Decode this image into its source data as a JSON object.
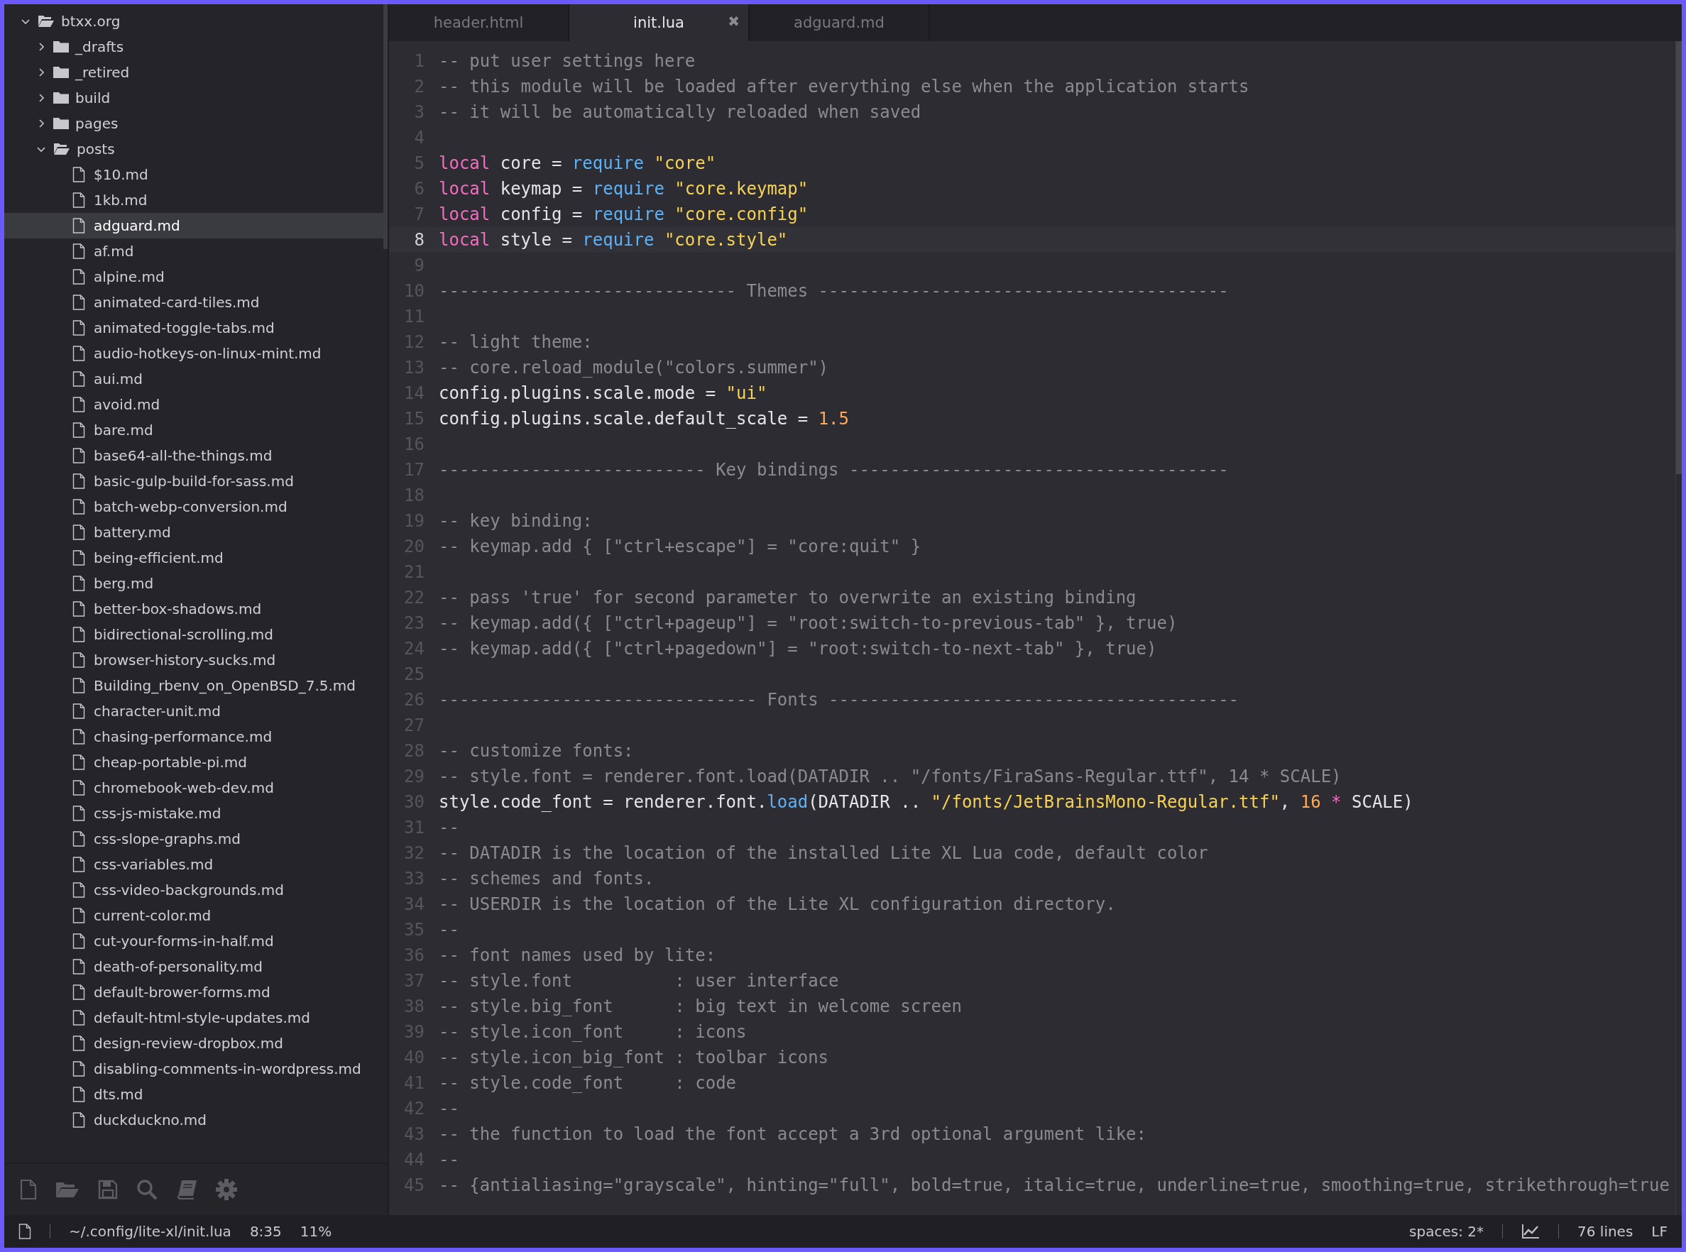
{
  "sidebar": {
    "tree": [
      {
        "name": "btxx.org",
        "kind": "folder",
        "expanded": true,
        "selected": false,
        "children": [
          {
            "name": "_drafts",
            "kind": "folder",
            "expanded": false,
            "selected": false
          },
          {
            "name": "_retired",
            "kind": "folder",
            "expanded": false,
            "selected": false
          },
          {
            "name": "build",
            "kind": "folder",
            "expanded": false,
            "selected": false
          },
          {
            "name": "pages",
            "kind": "folder",
            "expanded": false,
            "selected": false
          },
          {
            "name": "posts",
            "kind": "folder",
            "expanded": true,
            "selected": false,
            "children": [
              {
                "name": "$10.md",
                "kind": "file",
                "selected": false
              },
              {
                "name": "1kb.md",
                "kind": "file",
                "selected": false
              },
              {
                "name": "adguard.md",
                "kind": "file",
                "selected": true
              },
              {
                "name": "af.md",
                "kind": "file",
                "selected": false
              },
              {
                "name": "alpine.md",
                "kind": "file",
                "selected": false
              },
              {
                "name": "animated-card-tiles.md",
                "kind": "file",
                "selected": false
              },
              {
                "name": "animated-toggle-tabs.md",
                "kind": "file",
                "selected": false
              },
              {
                "name": "audio-hotkeys-on-linux-mint.md",
                "kind": "file",
                "selected": false
              },
              {
                "name": "aui.md",
                "kind": "file",
                "selected": false
              },
              {
                "name": "avoid.md",
                "kind": "file",
                "selected": false
              },
              {
                "name": "bare.md",
                "kind": "file",
                "selected": false
              },
              {
                "name": "base64-all-the-things.md",
                "kind": "file",
                "selected": false
              },
              {
                "name": "basic-gulp-build-for-sass.md",
                "kind": "file",
                "selected": false
              },
              {
                "name": "batch-webp-conversion.md",
                "kind": "file",
                "selected": false
              },
              {
                "name": "battery.md",
                "kind": "file",
                "selected": false
              },
              {
                "name": "being-efficient.md",
                "kind": "file",
                "selected": false
              },
              {
                "name": "berg.md",
                "kind": "file",
                "selected": false
              },
              {
                "name": "better-box-shadows.md",
                "kind": "file",
                "selected": false
              },
              {
                "name": "bidirectional-scrolling.md",
                "kind": "file",
                "selected": false
              },
              {
                "name": "browser-history-sucks.md",
                "kind": "file",
                "selected": false
              },
              {
                "name": "Building_rbenv_on_OpenBSD_7.5.md",
                "kind": "file",
                "selected": false
              },
              {
                "name": "character-unit.md",
                "kind": "file",
                "selected": false
              },
              {
                "name": "chasing-performance.md",
                "kind": "file",
                "selected": false
              },
              {
                "name": "cheap-portable-pi.md",
                "kind": "file",
                "selected": false
              },
              {
                "name": "chromebook-web-dev.md",
                "kind": "file",
                "selected": false
              },
              {
                "name": "css-js-mistake.md",
                "kind": "file",
                "selected": false
              },
              {
                "name": "css-slope-graphs.md",
                "kind": "file",
                "selected": false
              },
              {
                "name": "css-variables.md",
                "kind": "file",
                "selected": false
              },
              {
                "name": "css-video-backgrounds.md",
                "kind": "file",
                "selected": false
              },
              {
                "name": "current-color.md",
                "kind": "file",
                "selected": false
              },
              {
                "name": "cut-your-forms-in-half.md",
                "kind": "file",
                "selected": false
              },
              {
                "name": "death-of-personality.md",
                "kind": "file",
                "selected": false
              },
              {
                "name": "default-brower-forms.md",
                "kind": "file",
                "selected": false
              },
              {
                "name": "default-html-style-updates.md",
                "kind": "file",
                "selected": false
              },
              {
                "name": "design-review-dropbox.md",
                "kind": "file",
                "selected": false
              },
              {
                "name": "disabling-comments-in-wordpress.md",
                "kind": "file",
                "selected": false
              },
              {
                "name": "dts.md",
                "kind": "file",
                "selected": false
              },
              {
                "name": "duckduckno.md",
                "kind": "file",
                "selected": false
              }
            ]
          }
        ]
      }
    ],
    "toolbar": [
      {
        "kind": "new-file"
      },
      {
        "kind": "open-folder"
      },
      {
        "kind": "save"
      },
      {
        "kind": "search"
      },
      {
        "kind": "book"
      },
      {
        "kind": "settings"
      }
    ]
  },
  "tabs": [
    {
      "label": "header.html",
      "selected": false
    },
    {
      "label": "init.lua",
      "selected": true,
      "close": "✖"
    },
    {
      "label": "adguard.md",
      "selected": false
    }
  ],
  "editor": {
    "lines": [
      {
        "number": "1",
        "current": false,
        "tokens": [
          {
            "kind": "comment",
            "text": "-- put user settings here"
          }
        ]
      },
      {
        "number": "2",
        "current": false,
        "tokens": [
          {
            "kind": "comment",
            "text": "-- this module will be loaded after everything else when the application starts"
          }
        ]
      },
      {
        "number": "3",
        "current": false,
        "tokens": [
          {
            "kind": "comment",
            "text": "-- it will be automatically reloaded when saved"
          }
        ]
      },
      {
        "number": "4",
        "current": false
      },
      {
        "number": "5",
        "current": false,
        "tokens": [
          {
            "kind": "keyword",
            "text": "local"
          },
          {
            "kind": "normal",
            "text": " core = "
          },
          {
            "kind": "function",
            "text": "require"
          },
          {
            "kind": "string",
            "text": " \"core\""
          }
        ]
      },
      {
        "number": "6",
        "current": false,
        "tokens": [
          {
            "kind": "keyword",
            "text": "local"
          },
          {
            "kind": "normal",
            "text": " keymap = "
          },
          {
            "kind": "function",
            "text": "require"
          },
          {
            "kind": "string",
            "text": " \"core.keymap\""
          }
        ]
      },
      {
        "number": "7",
        "current": false,
        "tokens": [
          {
            "kind": "keyword",
            "text": "local"
          },
          {
            "kind": "normal",
            "text": " config = "
          },
          {
            "kind": "function",
            "text": "require"
          },
          {
            "kind": "string",
            "text": " \"core.config\""
          }
        ]
      },
      {
        "number": "8",
        "current": true,
        "tokens": [
          {
            "kind": "keyword",
            "text": "local"
          },
          {
            "kind": "normal",
            "text": " style = "
          },
          {
            "kind": "function",
            "text": "require"
          },
          {
            "kind": "string",
            "text": " \"core.style\""
          }
        ]
      },
      {
        "number": "9",
        "current": false
      },
      {
        "number": "10",
        "current": false,
        "tokens": [
          {
            "kind": "comment",
            "text": "----------------------------- Themes ----------------------------------------"
          }
        ]
      },
      {
        "number": "11",
        "current": false
      },
      {
        "number": "12",
        "current": false,
        "tokens": [
          {
            "kind": "comment",
            "text": "-- light theme:"
          }
        ]
      },
      {
        "number": "13",
        "current": false,
        "tokens": [
          {
            "kind": "comment",
            "text": "-- core.reload_module(\"colors.summer\")"
          }
        ]
      },
      {
        "number": "14",
        "current": false,
        "tokens": [
          {
            "kind": "normal",
            "text": "config.plugins.scale.mode = "
          },
          {
            "kind": "string",
            "text": "\"ui\""
          }
        ]
      },
      {
        "number": "15",
        "current": false,
        "tokens": [
          {
            "kind": "normal",
            "text": "config.plugins.scale.default_scale = "
          },
          {
            "kind": "number",
            "text": "1.5"
          }
        ]
      },
      {
        "number": "16",
        "current": false
      },
      {
        "number": "17",
        "current": false,
        "tokens": [
          {
            "kind": "comment",
            "text": "-------------------------- Key bindings -------------------------------------"
          }
        ]
      },
      {
        "number": "18",
        "current": false
      },
      {
        "number": "19",
        "current": false,
        "tokens": [
          {
            "kind": "comment",
            "text": "-- key binding:"
          }
        ]
      },
      {
        "number": "20",
        "current": false,
        "tokens": [
          {
            "kind": "comment",
            "text": "-- keymap.add { [\"ctrl+escape\"] = \"core:quit\" }"
          }
        ]
      },
      {
        "number": "21",
        "current": false
      },
      {
        "number": "22",
        "current": false,
        "tokens": [
          {
            "kind": "comment",
            "text": "-- pass 'true' for second parameter to overwrite an existing binding"
          }
        ]
      },
      {
        "number": "23",
        "current": false,
        "tokens": [
          {
            "kind": "comment",
            "text": "-- keymap.add({ [\"ctrl+pageup\"] = \"root:switch-to-previous-tab\" }, true)"
          }
        ]
      },
      {
        "number": "24",
        "current": false,
        "tokens": [
          {
            "kind": "comment",
            "text": "-- keymap.add({ [\"ctrl+pagedown\"] = \"root:switch-to-next-tab\" }, true)"
          }
        ]
      },
      {
        "number": "25",
        "current": false
      },
      {
        "number": "26",
        "current": false,
        "tokens": [
          {
            "kind": "comment",
            "text": "------------------------------- Fonts ----------------------------------------"
          }
        ]
      },
      {
        "number": "27",
        "current": false
      },
      {
        "number": "28",
        "current": false,
        "tokens": [
          {
            "kind": "comment",
            "text": "-- customize fonts:"
          }
        ]
      },
      {
        "number": "29",
        "current": false,
        "tokens": [
          {
            "kind": "comment",
            "text": "-- style.font = renderer.font.load(DATADIR .. \"/fonts/FiraSans-Regular.ttf\", 14 * SCALE)"
          }
        ]
      },
      {
        "number": "30",
        "current": false,
        "tokens": [
          {
            "kind": "normal",
            "text": "style.code_font = renderer.font."
          },
          {
            "kind": "function",
            "text": "load"
          },
          {
            "kind": "normal",
            "text": "(DATADIR .. "
          },
          {
            "kind": "string",
            "text": "\"/fonts/JetBrainsMono-Regular.ttf\""
          },
          {
            "kind": "normal",
            "text": ", "
          },
          {
            "kind": "number",
            "text": "16"
          },
          {
            "kind": "keyword",
            "text": " *"
          },
          {
            "kind": "normal",
            "text": " SCALE)"
          }
        ]
      },
      {
        "number": "31",
        "current": false,
        "tokens": [
          {
            "kind": "comment",
            "text": "--"
          }
        ]
      },
      {
        "number": "32",
        "current": false,
        "tokens": [
          {
            "kind": "comment",
            "text": "-- DATADIR is the location of the installed Lite XL Lua code, default color"
          }
        ]
      },
      {
        "number": "33",
        "current": false,
        "tokens": [
          {
            "kind": "comment",
            "text": "-- schemes and fonts."
          }
        ]
      },
      {
        "number": "34",
        "current": false,
        "tokens": [
          {
            "kind": "comment",
            "text": "-- USERDIR is the location of the Lite XL configuration directory."
          }
        ]
      },
      {
        "number": "35",
        "current": false,
        "tokens": [
          {
            "kind": "comment",
            "text": "--"
          }
        ]
      },
      {
        "number": "36",
        "current": false,
        "tokens": [
          {
            "kind": "comment",
            "text": "-- font names used by lite:"
          }
        ]
      },
      {
        "number": "37",
        "current": false,
        "tokens": [
          {
            "kind": "comment",
            "text": "-- style.font          : user interface"
          }
        ]
      },
      {
        "number": "38",
        "current": false,
        "tokens": [
          {
            "kind": "comment",
            "text": "-- style.big_font      : big text in welcome screen"
          }
        ]
      },
      {
        "number": "39",
        "current": false,
        "tokens": [
          {
            "kind": "comment",
            "text": "-- style.icon_font     : icons"
          }
        ]
      },
      {
        "number": "40",
        "current": false,
        "tokens": [
          {
            "kind": "comment",
            "text": "-- style.icon_big_font : toolbar icons"
          }
        ]
      },
      {
        "number": "41",
        "current": false,
        "tokens": [
          {
            "kind": "comment",
            "text": "-- style.code_font     : code"
          }
        ]
      },
      {
        "number": "42",
        "current": false,
        "tokens": [
          {
            "kind": "comment",
            "text": "--"
          }
        ]
      },
      {
        "number": "43",
        "current": false,
        "tokens": [
          {
            "kind": "comment",
            "text": "-- the function to load the font accept a 3rd optional argument like:"
          }
        ]
      },
      {
        "number": "44",
        "current": false,
        "tokens": [
          {
            "kind": "comment",
            "text": "--"
          }
        ]
      },
      {
        "number": "45",
        "current": false,
        "tokens": [
          {
            "kind": "comment",
            "text": "-- {antialiasing=\"grayscale\", hinting=\"full\", bold=true, italic=true, underline=true, smoothing=true, strikethrough=true"
          }
        ]
      }
    ]
  },
  "status_bar": {
    "path": "~/.config/lite-xl/init.lua",
    "position": "8:35",
    "percent": "11%",
    "indent": "spaces: 2*",
    "line_count": "76 lines",
    "line_ending": "LF"
  }
}
